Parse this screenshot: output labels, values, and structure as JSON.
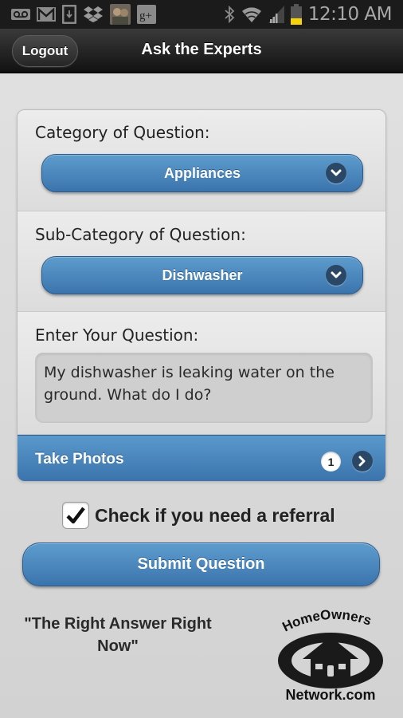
{
  "status_bar": {
    "left_icons": [
      "voicemail-icon",
      "gmail-icon",
      "download-icon",
      "dropbox-icon",
      "app-avatar-icon",
      "google-plus-icon"
    ],
    "google_plus_text": "g+",
    "right_icons": [
      "bluetooth-icon",
      "wifi-icon",
      "signal-icon",
      "battery-icon"
    ],
    "time": "12:10 AM",
    "battery_level": 0.35,
    "battery_color": "#f5d20a"
  },
  "header": {
    "logout_label": "Logout",
    "title": "Ask the Experts"
  },
  "form": {
    "category": {
      "label": "Category of Question:",
      "selected": "Appliances"
    },
    "subcategory": {
      "label": "Sub-Category of Question:",
      "selected": "Dishwasher"
    },
    "question": {
      "label": "Enter Your Question:",
      "value": "My dishwasher is leaking water on the ground. What do I do?"
    },
    "photos": {
      "label": "Take Photos",
      "count": "1"
    }
  },
  "referral": {
    "label": "Check if you need a referral",
    "checked": true
  },
  "submit_label": "Submit Question",
  "footer": {
    "tagline": "\"The Right Answer Right Now\"",
    "logo_top": "HomeOwners",
    "logo_bottom": "Network.com"
  },
  "colors": {
    "accent_blue": "#4a87bf",
    "icon_dark": "#2a4866"
  }
}
